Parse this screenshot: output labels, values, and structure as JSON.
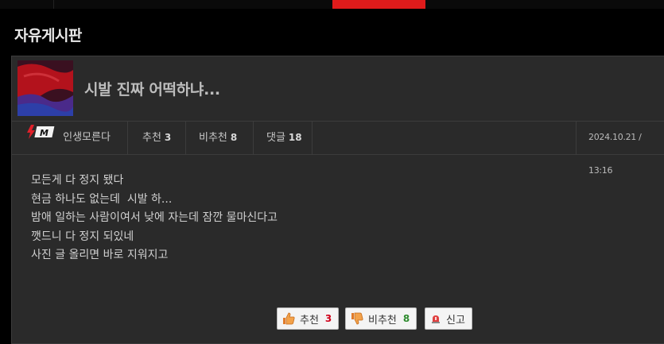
{
  "board": {
    "title": "자유게시판"
  },
  "post": {
    "title": "시발 진짜 어떡하냐...",
    "author": "인생모른다",
    "meta": {
      "recommend_label": "추천",
      "recommend_count": "3",
      "notrecommend_label": "비추천",
      "notrecommend_count": "8",
      "comments_label": "댓글",
      "comments_count": "18",
      "datetime": "2024.10.21 / 13:16"
    },
    "body": [
      "모든게 다 정지 됐다",
      "현금 하나도 없는데  시발 하...",
      "밤애 일하는 사람이여서 낮에 자는데 잠깐 물마신다고",
      "깻드니 다 정지 되있네",
      "사진 글 올리면 바로 지워지고"
    ],
    "actions": {
      "recommend_label": "추천",
      "recommend_count": "3",
      "notrecommend_label": "비추천",
      "notrecommend_count": "8",
      "report_label": "신고"
    }
  },
  "colors": {
    "accent": "#e01b1b",
    "recommend_count": "#d0021b",
    "notrecommend_count": "#2e8b2e"
  }
}
